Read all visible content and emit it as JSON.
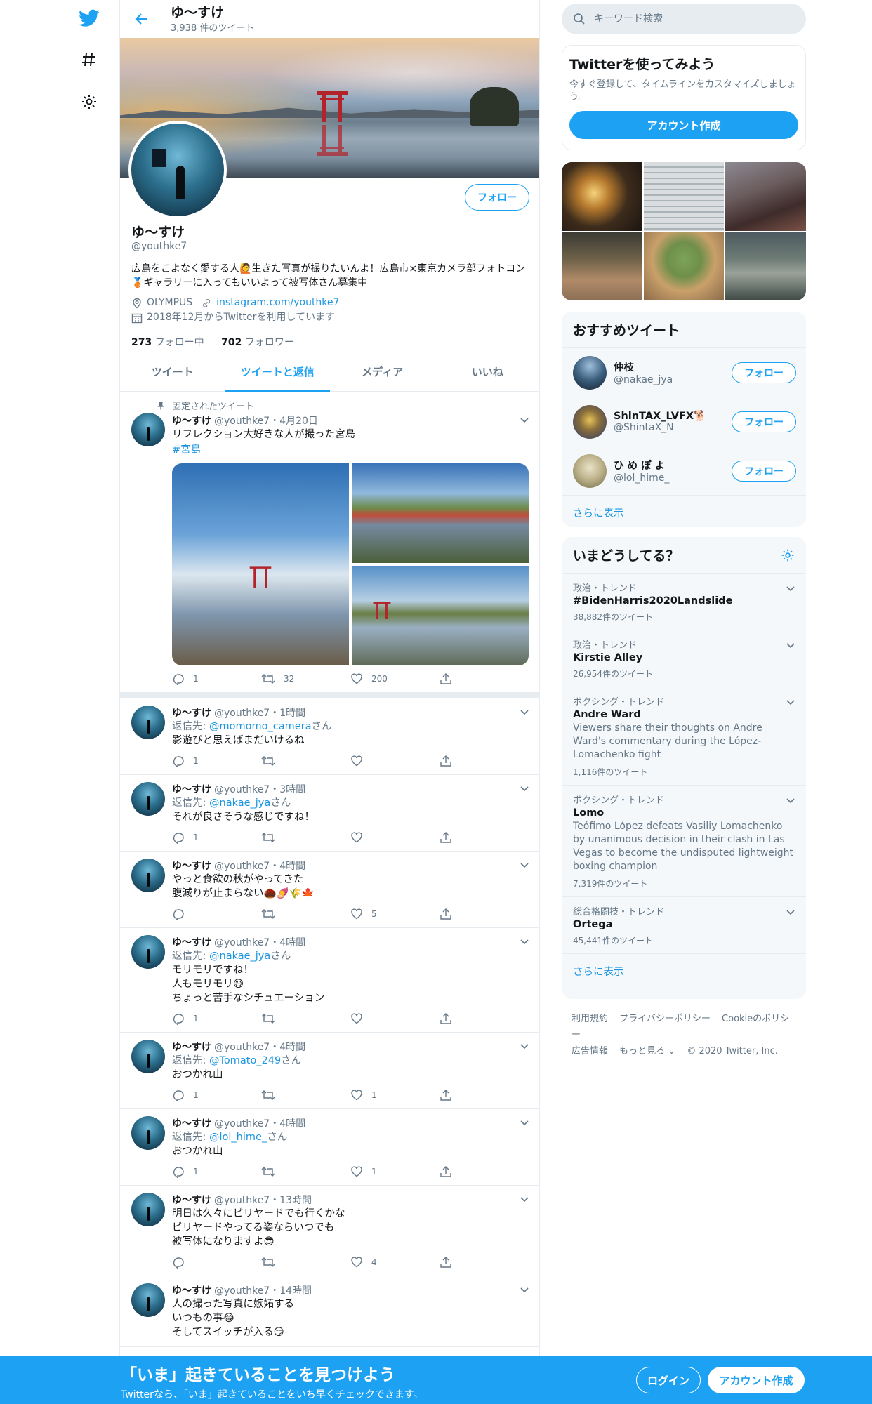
{
  "header": {
    "name": "ゆ〜すけ",
    "tweet_count": "3,938 件のツイート"
  },
  "profile": {
    "name": "ゆ〜すけ",
    "handle": "@youthke7",
    "follow_label": "フォロー",
    "bio": "広島をこよなく愛する人🙋生きた写真が撮りたいんよ！広島市×東京カメラ部フォトコン🥉ギャラリーに入ってもいいよって被写体さん募集中",
    "location": "OLYMPUS",
    "url": "instagram.com/youthke7",
    "joined": "2018年12月からTwitterを利用しています",
    "following_count": "273",
    "following_label": "フォロー中",
    "followers_count": "702",
    "followers_label": "フォロワー"
  },
  "tabs": [
    "ツイート",
    "ツイートと返信",
    "メディア",
    "いいね"
  ],
  "pinned": {
    "label": "固定されたツイート",
    "name": "ゆ〜すけ",
    "meta": "@youthke7・4月20日",
    "text": "リフレクション大好きな人が撮った宮島",
    "hashtag": "#宮島",
    "replies": "1",
    "retweets": "32",
    "likes": "200"
  },
  "tweets": [
    {
      "name": "ゆ〜すけ",
      "meta": "@youthke7・1時間",
      "reply_prefix": "返信先: ",
      "reply_to": "@momomo_camera",
      "reply_suffix": "さん",
      "text": "影遊びと思えばまだいけるね",
      "replies": "1",
      "retweets": "",
      "likes": ""
    },
    {
      "name": "ゆ〜すけ",
      "meta": "@youthke7・3時間",
      "reply_prefix": "返信先: ",
      "reply_to": "@nakae_jya",
      "reply_suffix": "さん",
      "text": "それが良さそうな感じですね！",
      "replies": "1",
      "retweets": "",
      "likes": ""
    },
    {
      "name": "ゆ〜すけ",
      "meta": "@youthke7・4時間",
      "text": "やっと食欲の秋がやってきた\n腹減りが止まらない🌰🍠🌾🍁",
      "replies": "",
      "retweets": "",
      "likes": "5"
    },
    {
      "name": "ゆ〜すけ",
      "meta": "@youthke7・4時間",
      "reply_prefix": "返信先: ",
      "reply_to": "@nakae_jya",
      "reply_suffix": "さん",
      "text": "モリモリですね！\n人もモリモリ😅\nちょっと苦手なシチュエーション",
      "replies": "1",
      "retweets": "",
      "likes": ""
    },
    {
      "name": "ゆ〜すけ",
      "meta": "@youthke7・4時間",
      "reply_prefix": "返信先: ",
      "reply_to": "@Tomato_249",
      "reply_suffix": "さん",
      "text": "おつかれ山",
      "replies": "1",
      "retweets": "",
      "likes": "1"
    },
    {
      "name": "ゆ〜すけ",
      "meta": "@youthke7・4時間",
      "reply_prefix": "返信先: ",
      "reply_to": "@lol_hime_",
      "reply_suffix": "さん",
      "text": "おつかれ山",
      "replies": "1",
      "retweets": "",
      "likes": "1"
    },
    {
      "name": "ゆ〜すけ",
      "meta": "@youthke7・13時間",
      "text": "明日は久々にビリヤードでも行くかな\nビリヤードやってる姿ならいつでも\n被写体になりますよ😎",
      "replies": "",
      "retweets": "",
      "likes": "4"
    },
    {
      "name": "ゆ〜すけ",
      "meta": "@youthke7・14時間",
      "text": "人の撮った写真に嫉妬する\nいつもの事😂\nそしてスイッチが入る😏",
      "replies": "",
      "retweets": "",
      "likes": ""
    }
  ],
  "search": {
    "placeholder": "キーワード検索"
  },
  "signup_box": {
    "title": "Twitterを使ってみよう",
    "desc": "今すぐ登録して、タイムラインをカスタマイズしましょう。",
    "button": "アカウント作成"
  },
  "recommend": {
    "title": "おすすめツイート",
    "items": [
      {
        "name": "仲枝",
        "handle": "@nakae_jya",
        "button": "フォロー"
      },
      {
        "name": "ShinTAX_LVFX🐕",
        "handle": "@ShintaX_N",
        "button": "フォロー"
      },
      {
        "name": "ひ め ぽ よ",
        "handle": "@lol_hime_",
        "button": "フォロー"
      }
    ],
    "more": "さらに表示"
  },
  "trends": {
    "title": "いまどうしてる？",
    "items": [
      {
        "category": "政治・トレンド",
        "name": "#BidenHarris2020Landslide",
        "desc": "",
        "count": "38,882件のツイート"
      },
      {
        "category": "政治・トレンド",
        "name": "Kirstie Alley",
        "desc": "",
        "count": "26,954件のツイート"
      },
      {
        "category": "ボクシング・トレンド",
        "name": "Andre Ward",
        "desc": "Viewers share their thoughts on Andre Ward's commentary during the López-Lomachenko fight",
        "count": "1,116件のツイート"
      },
      {
        "category": "ボクシング・トレンド",
        "name": "Lomo",
        "desc": "Teófimo López defeats Vasiliy Lomachenko by unanimous decision in their clash in Las Vegas to become the undisputed lightweight boxing champion",
        "count": "7,319件のツイート"
      },
      {
        "category": "総合格闘技・トレンド",
        "name": "Ortega",
        "desc": "",
        "count": "45,441件のツイート"
      }
    ],
    "more": "さらに表示"
  },
  "footer": {
    "line1": [
      "利用規約",
      "プライバシーポリシー",
      "Cookieのポリシー"
    ],
    "line2": [
      "広告情報",
      "もっと見る ⌄",
      "© 2020 Twitter, Inc."
    ]
  },
  "bottombar": {
    "title": "「いま」起きていることを見つけよう",
    "subtitle": "Twitterなら、「いま」起きていることをいち早くチェックできます。",
    "login": "ログイン",
    "signup": "アカウント作成"
  },
  "colors": {
    "accent": "#1da1f2",
    "text": "#14171a",
    "muted": "#657786",
    "border": "#e6ecf0",
    "panel": "#f5f8fa"
  }
}
